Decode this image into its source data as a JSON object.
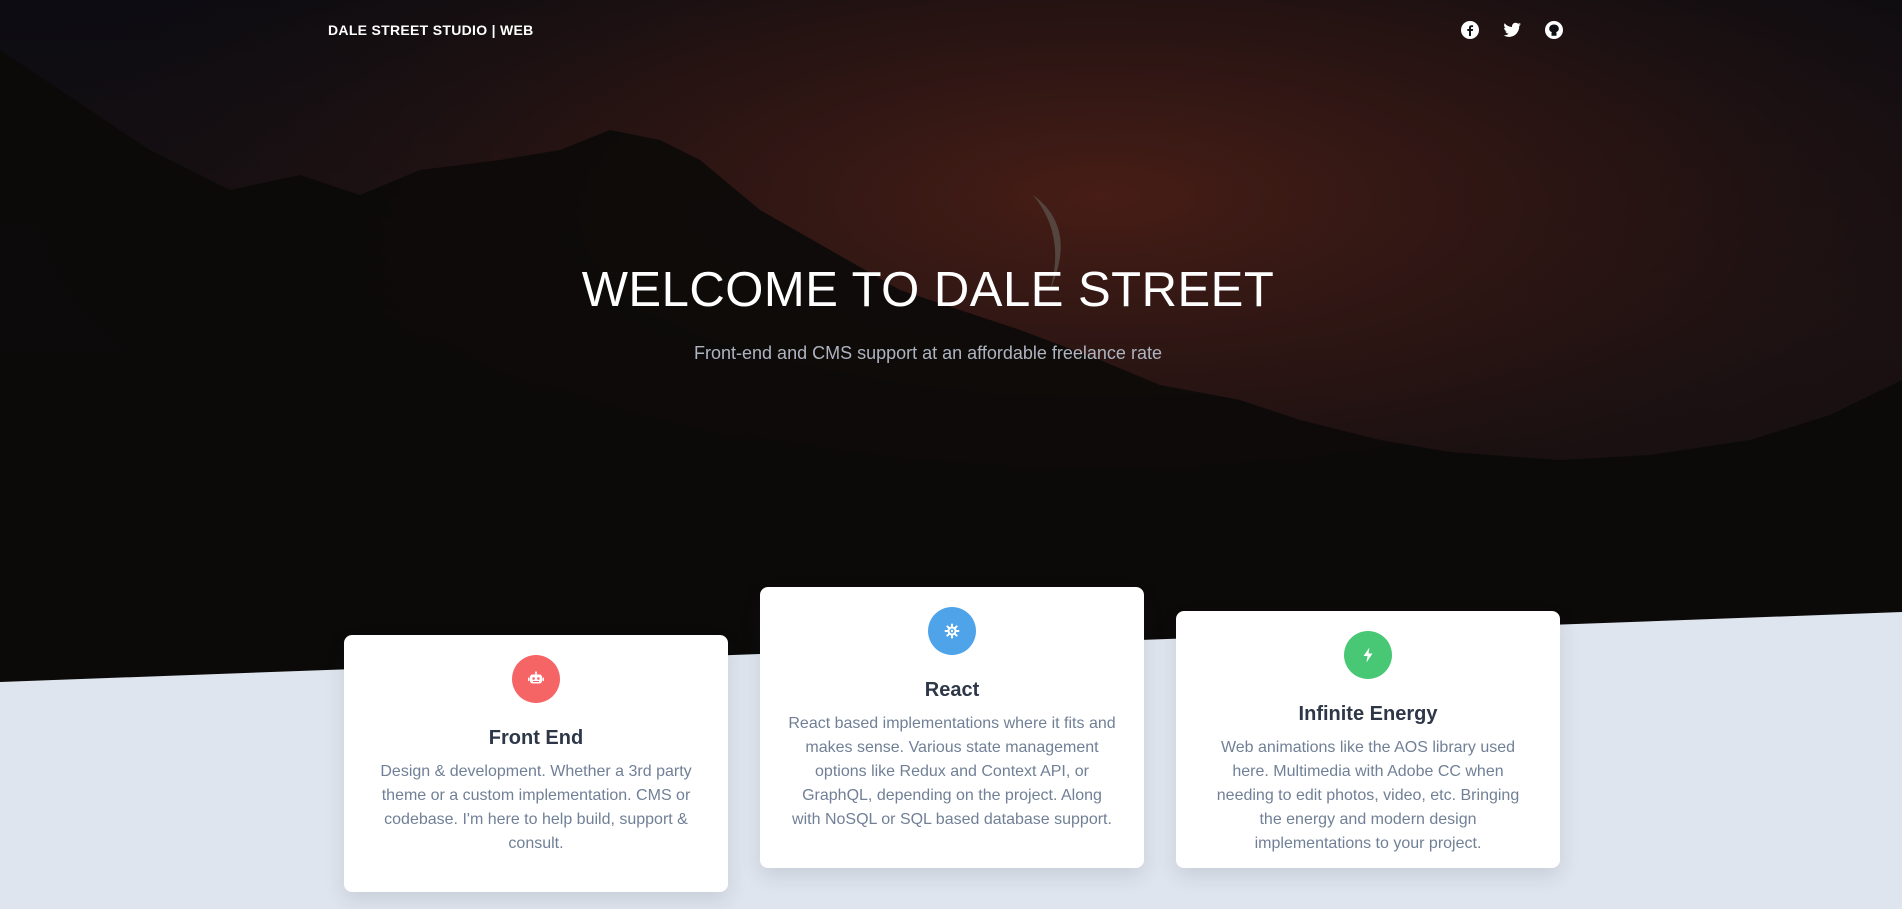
{
  "nav": {
    "brand": "DALE STREET STUDIO | WEB",
    "social": [
      {
        "icon": "facebook-icon"
      },
      {
        "icon": "twitter-icon"
      },
      {
        "icon": "github-icon"
      }
    ]
  },
  "hero": {
    "title": "WELCOME TO DALE STREET",
    "subtitle": "Front-end and CMS support at an affordable freelance rate"
  },
  "cards": [
    {
      "icon": "robot-icon",
      "color": "#f56565",
      "title": "Front End",
      "text": "Design & development. Whether a 3rd party theme or a custom implementation. CMS or codebase. I'm here to help build, support & consult."
    },
    {
      "icon": "react-icon",
      "color": "#4fa3e8",
      "title": "React",
      "text": "React based implementations where it fits and makes sense. Various state management options like Redux and Context API, or GraphQL, depending on the project. Along with NoSQL or SQL based database support."
    },
    {
      "icon": "bolt-icon",
      "color": "#48c774",
      "title": "Infinite Energy",
      "text": "Web animations like the AOS library used here. Multimedia with Adobe CC when needing to edit photos, video, etc. Bringing the energy and modern design implementations to your project."
    }
  ],
  "colors": {
    "section_bg": "#dfe5ee",
    "hero_dark": "#0d0d10",
    "hero_glow": "#3a1a14"
  }
}
